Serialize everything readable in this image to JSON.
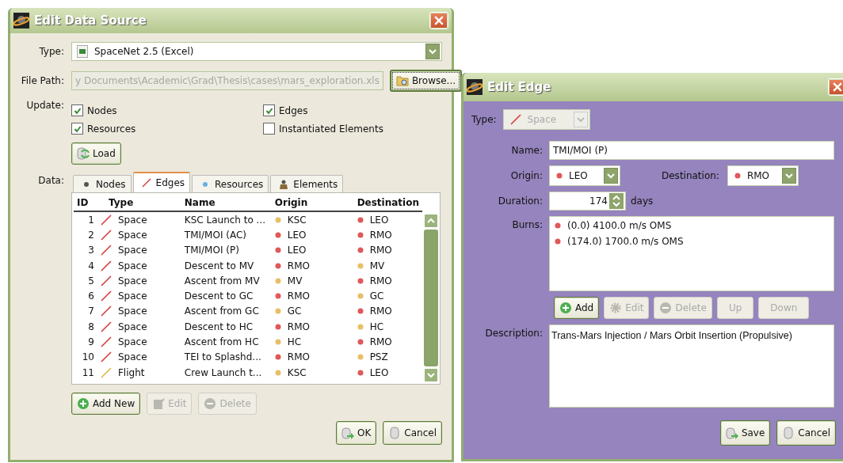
{
  "data_source_window": {
    "title": "Edit Data Source",
    "type_label": "Type:",
    "type_value": "SpaceNet 2.5 (Excel)",
    "file_path_label": "File Path:",
    "file_path": "y Documents\\Academic\\Grad\\Thesis\\cases\\mars_exploration.xls",
    "browse_button": "Browse...",
    "update_label": "Update:",
    "update_options": [
      {
        "label": "Nodes",
        "checked": true
      },
      {
        "label": "Edges",
        "checked": true
      },
      {
        "label": "Resources",
        "checked": true
      },
      {
        "label": "Instantiated Elements",
        "checked": false
      }
    ],
    "load_button": "Load",
    "data_label": "Data:",
    "tabs": [
      {
        "label": "Nodes",
        "kind": "node",
        "selected": false
      },
      {
        "label": "Edges",
        "kind": "edge",
        "selected": true
      },
      {
        "label": "Resources",
        "kind": "resource",
        "selected": false
      },
      {
        "label": "Elements",
        "kind": "element",
        "selected": false
      }
    ],
    "table": {
      "columns": [
        "ID",
        "Type",
        "Name",
        "Origin",
        "Destination"
      ],
      "rows": [
        {
          "id": "1",
          "type": {
            "label": "Space",
            "color": "#d83a3a"
          },
          "name": "KSC Launch to ...",
          "origin": {
            "label": "KSC",
            "color": "#e8bf66"
          },
          "destination": {
            "label": "LEO",
            "color": "#e05858"
          }
        },
        {
          "id": "2",
          "type": {
            "label": "Space",
            "color": "#d83a3a"
          },
          "name": "TMI/MOI (AC)",
          "origin": {
            "label": "LEO",
            "color": "#e05858"
          },
          "destination": {
            "label": "RMO",
            "color": "#e05858"
          }
        },
        {
          "id": "3",
          "type": {
            "label": "Space",
            "color": "#d83a3a"
          },
          "name": "TMI/MOI (P)",
          "origin": {
            "label": "LEO",
            "color": "#e05858"
          },
          "destination": {
            "label": "RMO",
            "color": "#e05858"
          }
        },
        {
          "id": "4",
          "type": {
            "label": "Space",
            "color": "#d83a3a"
          },
          "name": "Descent to MV",
          "origin": {
            "label": "RMO",
            "color": "#e05858"
          },
          "destination": {
            "label": "MV",
            "color": "#e8bf66"
          }
        },
        {
          "id": "5",
          "type": {
            "label": "Space",
            "color": "#d83a3a"
          },
          "name": "Ascent from MV",
          "origin": {
            "label": "MV",
            "color": "#e8bf66"
          },
          "destination": {
            "label": "RMO",
            "color": "#e05858"
          }
        },
        {
          "id": "6",
          "type": {
            "label": "Space",
            "color": "#d83a3a"
          },
          "name": "Descent to GC",
          "origin": {
            "label": "RMO",
            "color": "#e05858"
          },
          "destination": {
            "label": "GC",
            "color": "#e8bf66"
          }
        },
        {
          "id": "7",
          "type": {
            "label": "Space",
            "color": "#d83a3a"
          },
          "name": "Ascent from GC",
          "origin": {
            "label": "GC",
            "color": "#e8bf66"
          },
          "destination": {
            "label": "RMO",
            "color": "#e05858"
          }
        },
        {
          "id": "8",
          "type": {
            "label": "Space",
            "color": "#d83a3a"
          },
          "name": "Descent to HC",
          "origin": {
            "label": "RMO",
            "color": "#e05858"
          },
          "destination": {
            "label": "HC",
            "color": "#e8bf66"
          }
        },
        {
          "id": "9",
          "type": {
            "label": "Space",
            "color": "#d83a3a"
          },
          "name": "Ascent from HC",
          "origin": {
            "label": "HC",
            "color": "#e8bf66"
          },
          "destination": {
            "label": "RMO",
            "color": "#e05858"
          }
        },
        {
          "id": "10",
          "type": {
            "label": "Space",
            "color": "#d83a3a"
          },
          "name": "TEI to Splashd...",
          "origin": {
            "label": "RMO",
            "color": "#e05858"
          },
          "destination": {
            "label": "PSZ",
            "color": "#e8bf66"
          }
        },
        {
          "id": "11",
          "type": {
            "label": "Flight",
            "color": "#e0b448"
          },
          "name": "Crew Launch t...",
          "origin": {
            "label": "KSC",
            "color": "#e8bf66"
          },
          "destination": {
            "label": "LEO",
            "color": "#e05858"
          }
        }
      ]
    },
    "actions": [
      {
        "label": "Add New",
        "kind": "add",
        "disabled": false
      },
      {
        "label": "Edit",
        "kind": "edit",
        "disabled": true
      },
      {
        "label": "Delete",
        "kind": "delete",
        "disabled": true
      }
    ],
    "dialog_buttons": [
      {
        "label": "OK",
        "kind": "ok"
      },
      {
        "label": "Cancel",
        "kind": "cancel"
      }
    ]
  },
  "edit_edge_window": {
    "title": "Edit Edge",
    "type_label": "Type:",
    "type_field": {
      "value": "Space",
      "disabled": true
    },
    "name_label": "Name:",
    "name_value": "TMI/MOI (P)",
    "origin_label": "Origin:",
    "origin_value": "LEO",
    "destination_label": "Destination:",
    "destination_value": "RMO",
    "duration_label": "Duration:",
    "duration_value": "174",
    "duration_unit": "days",
    "burns_label": "Burns:",
    "burns": [
      "(0.0) 4100.0 m/s OMS",
      "(174.0) 1700.0 m/s OMS"
    ],
    "burn_actions": [
      {
        "label": "Add",
        "kind": "add",
        "disabled": false
      },
      {
        "label": "Edit",
        "kind": "gear",
        "disabled": true
      },
      {
        "label": "Delete",
        "kind": "delete",
        "disabled": true
      },
      {
        "label": "Up",
        "kind": "plain",
        "disabled": true
      },
      {
        "label": "Down",
        "kind": "plain",
        "disabled": true
      }
    ],
    "description_label": "Description:",
    "description": "Trans-Mars Injection / Mars Orbit Insertion (Propulsive)",
    "dialog_buttons": [
      {
        "label": "Save",
        "kind": "ok"
      },
      {
        "label": "Cancel",
        "kind": "cancel"
      }
    ]
  }
}
